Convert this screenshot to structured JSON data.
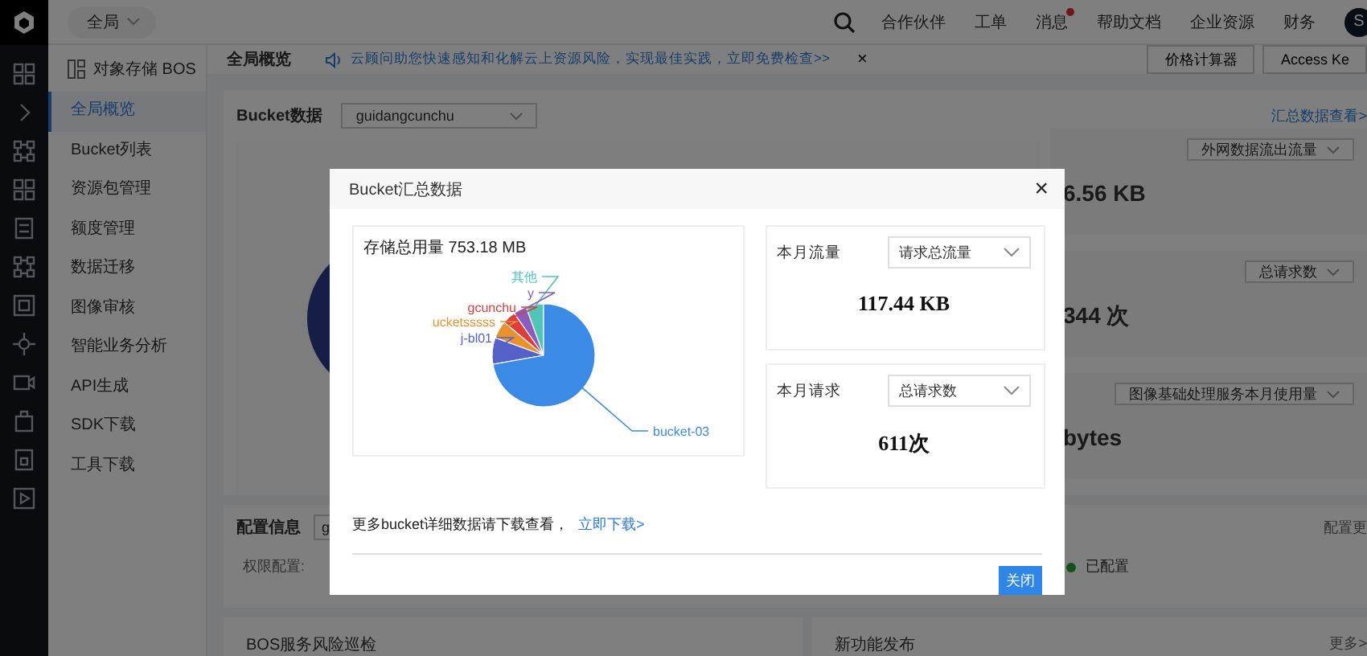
{
  "topbar": {
    "scope": "全局",
    "links": [
      {
        "label": "合作伙伴",
        "badge": false
      },
      {
        "label": "工单",
        "badge": false
      },
      {
        "label": "消息",
        "badge": true
      },
      {
        "label": "帮助文档",
        "badge": false
      },
      {
        "label": "企业资源",
        "badge": false
      },
      {
        "label": "财务",
        "badge": false
      }
    ],
    "avatar": "S"
  },
  "sidebar": {
    "title": "对象存储 BOS",
    "items": [
      {
        "label": "全局概览",
        "selected": true
      },
      {
        "label": "Bucket列表",
        "selected": false
      },
      {
        "label": "资源包管理",
        "selected": false
      },
      {
        "label": "额度管理",
        "selected": false
      },
      {
        "label": "数据迁移",
        "selected": false
      },
      {
        "label": "图像审核",
        "selected": false
      },
      {
        "label": "智能业务分析",
        "selected": false
      },
      {
        "label": "API生成",
        "selected": false
      },
      {
        "label": "SDK下载",
        "selected": false
      },
      {
        "label": "工具下载",
        "selected": false
      }
    ]
  },
  "header": {
    "title": "全局概览",
    "notice": "云顾问助您快速感知和化解云上资源风险，实现最佳实践，立即免费检查>>",
    "notice_close": "×",
    "buttons": [
      "价格计算器",
      "Access Ke"
    ]
  },
  "bucket": {
    "title": "Bucket数据",
    "select": "guidangcunchu",
    "link": "汇总数据查看>",
    "panels": [
      {
        "select": "外网数据流出流量",
        "value": "6.56 KB"
      },
      {
        "select": "总请求数",
        "value": "344 次"
      },
      {
        "select": "图像基础处理服务本月使用量",
        "value": "bytes"
      }
    ]
  },
  "config": {
    "title": "配置信息",
    "select": "g",
    "label": "权限配置:",
    "link": "配置更",
    "status": "已配置"
  },
  "cards": [
    {
      "title": "BOS服务风险巡检"
    },
    {
      "title": "新功能发布",
      "link": "更多>"
    }
  ],
  "modal": {
    "title": "Bucket汇总数据",
    "close": "×",
    "storage_label": "存储总用量 753.18 MB",
    "slices": [
      {
        "label": "其他",
        "color": "#4fc4b9"
      },
      {
        "label": "y",
        "color": "#8a5cc0"
      },
      {
        "label": "gcunchu",
        "color": "#dd3d3d"
      },
      {
        "label": "ucketsssss",
        "color": "#e8912f"
      },
      {
        "label": "j-bl01",
        "color": "#5561c9"
      },
      {
        "label": "bucket-03",
        "color": "#3b8ae6"
      }
    ],
    "stats": [
      {
        "label": "本月流量",
        "select": "请求总流量",
        "value": "117.44 KB"
      },
      {
        "label": "本月请求",
        "select": "总请求数",
        "value": "611次"
      }
    ],
    "footnote": "更多bucket详细数据请下载查看，",
    "footnote_link": "立即下载>",
    "button": "关闭"
  }
}
